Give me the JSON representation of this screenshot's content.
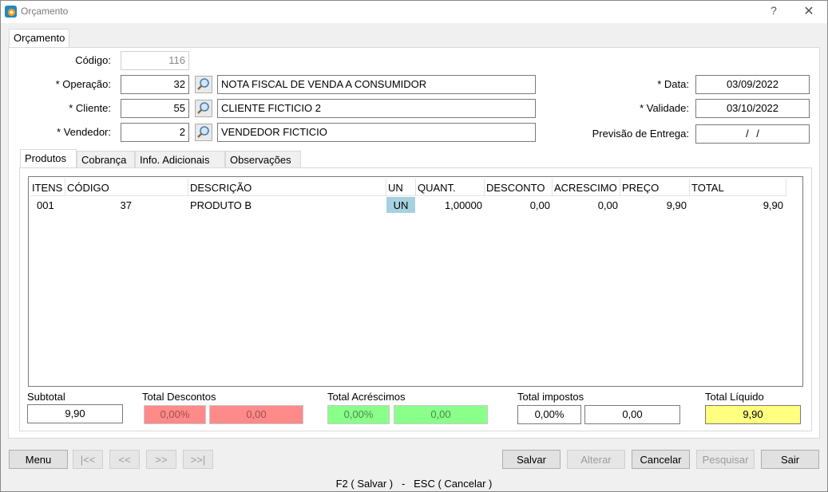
{
  "window": {
    "title": "Orçamento",
    "help": "?",
    "close": "✕"
  },
  "main_tab": "Orçamento",
  "form": {
    "codigo_label": "Código:",
    "codigo_value": "116",
    "operacao_label": "* Operação:",
    "operacao_code": "32",
    "operacao_desc": "NOTA FISCAL DE VENDA A CONSUMIDOR",
    "cliente_label": "* Cliente:",
    "cliente_code": "55",
    "cliente_desc": "CLIENTE FICTICIO 2",
    "vendedor_label": "* Vendedor:",
    "vendedor_code": "2",
    "vendedor_desc": "VENDEDOR FICTICIO",
    "data_label": "* Data:",
    "data_value": "03/09/2022",
    "validade_label": "* Validade:",
    "validade_value": "03/10/2022",
    "previsao_label": "Previsão de Entrega:",
    "previsao_value": "/  /"
  },
  "sub_tabs": [
    "Produtos",
    "Cobrança",
    "Info. Adicionais",
    "Observações"
  ],
  "grid": {
    "columns": [
      "ITENS",
      "CÓDIGO",
      "DESCRIÇÃO",
      "UN",
      "QUANT.",
      "DESCONTO",
      "ACRESCIMO",
      "PREÇO",
      "TOTAL"
    ],
    "rows": [
      [
        "001",
        "37",
        "PRODUTO B",
        "UN",
        "1,00000",
        "0,00",
        "0,00",
        "9,90",
        "9,90"
      ]
    ]
  },
  "totals": {
    "subtotal_label": "Subtotal",
    "subtotal_value": "9,90",
    "descontos_label": "Total Descontos",
    "descontos_pct": "0,00%",
    "descontos_value": "0,00",
    "acrescimos_label": "Total Acréscimos",
    "acrescimos_pct": "0,00%",
    "acrescimos_value": "0,00",
    "impostos_label": "Total impostos",
    "impostos_pct": "0,00%",
    "impostos_value": "0,00",
    "liquido_label": "Total Líquido",
    "liquido_value": "9,90"
  },
  "toolbar": {
    "menu": "Menu",
    "first": "|<<",
    "prev": "<<",
    "next": ">>",
    "last": ">>|",
    "salvar": "Salvar",
    "alterar": "Alterar",
    "cancelar": "Cancelar",
    "pesquisar": "Pesquisar",
    "sair": "Sair"
  },
  "footer": "F2 ( Salvar )   -   ESC ( Cancelar )",
  "colors": {
    "discount_red": "#ff8a8a",
    "addition_green": "#8aff8a",
    "total_yellow": "#ffff80",
    "unit_highlight": "#a6d1e0"
  }
}
